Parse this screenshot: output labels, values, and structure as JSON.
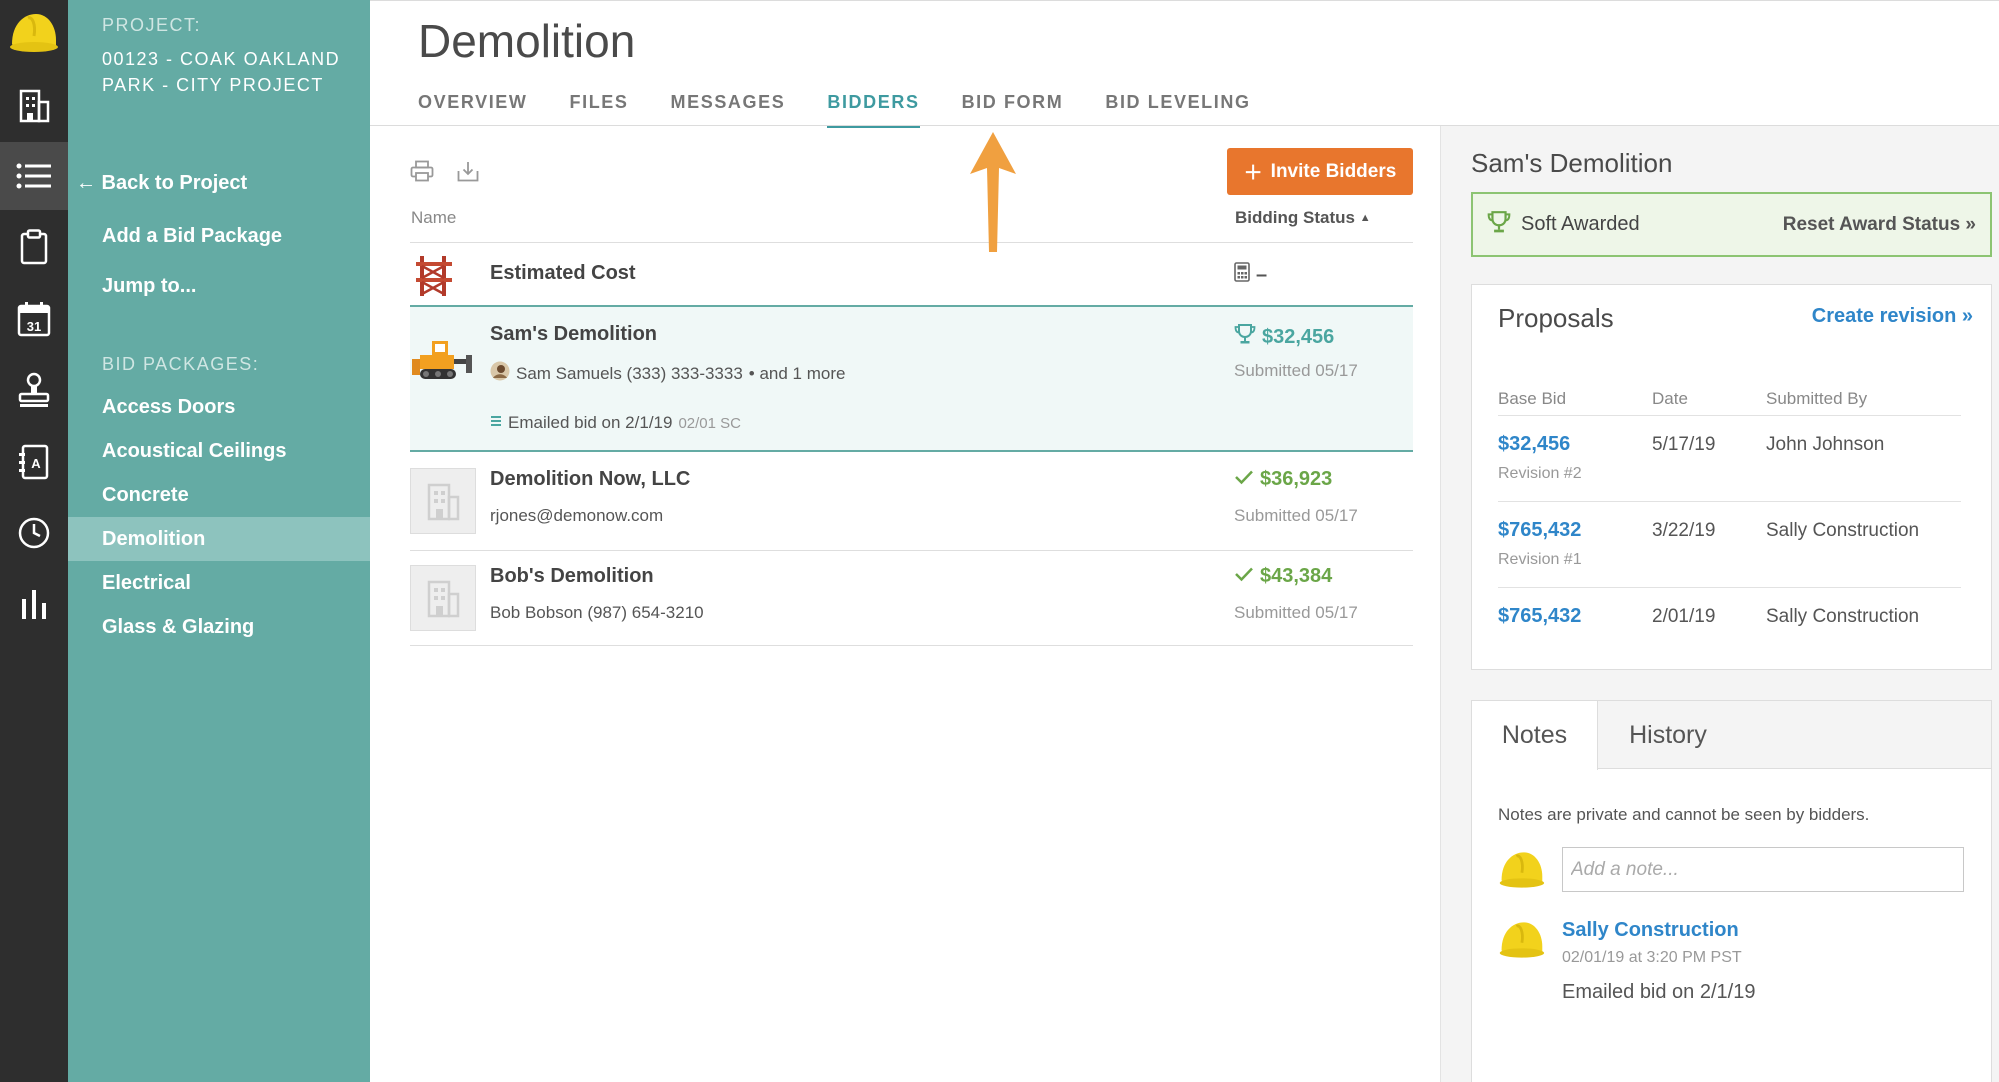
{
  "sidebar": {
    "project_label": "PROJECT:",
    "project_name": "00123 - COAK Oakland Park - City Project",
    "back_label": "← Back to Project",
    "add_package_label": "Add a Bid Package",
    "jump_label": "Jump to...",
    "packages_label": "BID PACKAGES:",
    "packages": [
      {
        "label": "Access Doors"
      },
      {
        "label": "Acoustical Ceilings"
      },
      {
        "label": "Concrete"
      },
      {
        "label": "Demolition"
      },
      {
        "label": "Electrical"
      },
      {
        "label": "Glass & Glazing"
      }
    ],
    "active_package": "Demolition"
  },
  "header": {
    "title": "Demolition",
    "tabs": [
      {
        "label": "OVERVIEW"
      },
      {
        "label": "FILES"
      },
      {
        "label": "MESSAGES"
      },
      {
        "label": "BIDDERS"
      },
      {
        "label": "BID FORM"
      },
      {
        "label": "BID LEVELING"
      }
    ],
    "active_tab": "BIDDERS"
  },
  "bidders": {
    "invite_label": "Invite Bidders",
    "col_name": "Name",
    "col_status": "Bidding Status",
    "estimated": {
      "name": "Estimated Cost",
      "value": "–"
    },
    "rows": [
      {
        "name": "Sam's Demolition",
        "contact": "Sam Samuels (333) 333-3333",
        "extra": "• and 1 more",
        "note": "Emailed bid on 2/1/19",
        "note_meta": "02/01 SC",
        "amount": "$32,456",
        "submitted": "Submitted 05/17",
        "status": "awarded"
      },
      {
        "name": "Demolition Now, LLC",
        "contact": "rjones@demonow.com",
        "amount": "$36,923",
        "submitted": "Submitted 05/17",
        "status": "submitted"
      },
      {
        "name": "Bob's Demolition",
        "contact": "Bob Bobson (987) 654-3210",
        "amount": "$43,384",
        "submitted": "Submitted 05/17",
        "status": "submitted"
      }
    ]
  },
  "detail": {
    "title": "Sam's Demolition",
    "award_status": "Soft Awarded",
    "reset_label": "Reset Award Status »",
    "proposals": {
      "title": "Proposals",
      "create_label": "Create revision »",
      "headers": {
        "bid": "Base Bid",
        "date": "Date",
        "by": "Submitted By"
      },
      "rows": [
        {
          "bid": "$32,456",
          "revision": "Revision #2",
          "date": "5/17/19",
          "by": "John Johnson"
        },
        {
          "bid": "$765,432",
          "revision": "Revision #1",
          "date": "3/22/19",
          "by": "Sally Construction"
        },
        {
          "bid": "$765,432",
          "revision": "",
          "date": "2/01/19",
          "by": "Sally Construction"
        }
      ]
    },
    "notes": {
      "tab_notes": "Notes",
      "tab_history": "History",
      "privacy": "Notes are private and cannot be seen by bidders.",
      "placeholder": "Add a note...",
      "entries": [
        {
          "author": "Sally Construction",
          "meta": "02/01/19 at 3:20 PM PST",
          "body": "Emailed bid on 2/1/19"
        }
      ]
    }
  },
  "colors": {
    "sidebar": "#64aba4",
    "accent_teal": "#3e9aa0",
    "invite_orange": "#e8762d",
    "link_blue": "#2f86c9",
    "success_green": "#6ba648",
    "arrow_orange": "#f0a040"
  }
}
